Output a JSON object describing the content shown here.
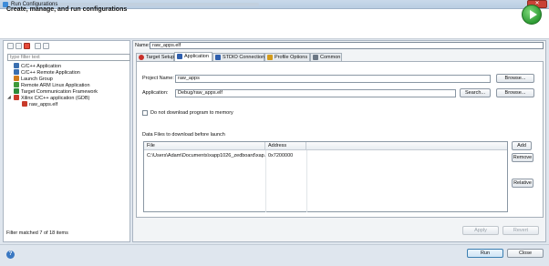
{
  "window": {
    "title": "Run Configurations",
    "close_glyph": "✕"
  },
  "header": {
    "title": "Create, manage, and run configurations",
    "run_icon": "run-play-icon"
  },
  "left_panel": {
    "toolbar_icons": [
      "new-config-icon",
      "duplicate-icon",
      "delete-icon",
      "collapse-all-icon",
      "filter-icon"
    ],
    "filter_placeholder": "type filter text",
    "tree": [
      {
        "label": "C/C++ Application",
        "icon": "c-app-icon",
        "color": "#3a6fb0"
      },
      {
        "label": "C/C++ Remote Application",
        "icon": "c-remote-icon",
        "color": "#3a6fb0"
      },
      {
        "label": "Launch Group",
        "icon": "launch-group-icon",
        "color": "#d07a1a"
      },
      {
        "label": "Remote ARM Linux Application",
        "icon": "arm-linux-icon",
        "color": "#3f9a3a"
      },
      {
        "label": "Target Communication Framework",
        "icon": "tcf-icon",
        "color": "#2c8b3a"
      },
      {
        "label": "Xilinx C/C++ application (GDB)",
        "icon": "xilinx-icon",
        "color": "#c83a2a",
        "expanded": true,
        "twisty": "◢"
      },
      {
        "label": "raw_apps.elf",
        "icon": "elf-config-icon",
        "color": "#c83a2a",
        "child": true
      }
    ],
    "status": "Filter matched 7 of 18 items"
  },
  "config": {
    "name_label": "Name:",
    "name_value": "raw_apps.elf",
    "tabs": [
      {
        "label": "Target Setup",
        "icon": "target-icon",
        "color": "#c8302a"
      },
      {
        "label": "Application",
        "icon": "application-icon",
        "color": "#2f5fae",
        "active": true
      },
      {
        "label": "STDIO Connection",
        "icon": "stdio-icon",
        "color": "#2f5fae"
      },
      {
        "label": "Profile Options",
        "icon": "profile-icon",
        "color": "#d39b1c"
      },
      {
        "label": "Common",
        "icon": "common-icon",
        "color": "#6c7784"
      }
    ],
    "project_name_label": "Project Name:",
    "project_name_value": "raw_apps",
    "browse_label": "Browse...",
    "application_label": "Application:",
    "application_value": "Debug/raw_apps.elf",
    "search_label": "Search...",
    "checkbox_label": "Do not download program to memory",
    "checkbox_checked": false,
    "data_files_label": "Data Files to download before launch",
    "table": {
      "columns": [
        "File",
        "Address"
      ],
      "rows": [
        {
          "file": "C:\\Users\\Adam\\Documents\\xapp1026_zedboard\\xap...",
          "address": "0x7200000"
        }
      ]
    },
    "add_label": "Add",
    "remove_label": "Remove",
    "relative_label": "Relative",
    "apply_label": "Apply",
    "revert_label": "Revert"
  },
  "footer": {
    "help_icon": "help-icon",
    "run_label": "Run",
    "close_label": "Close"
  }
}
